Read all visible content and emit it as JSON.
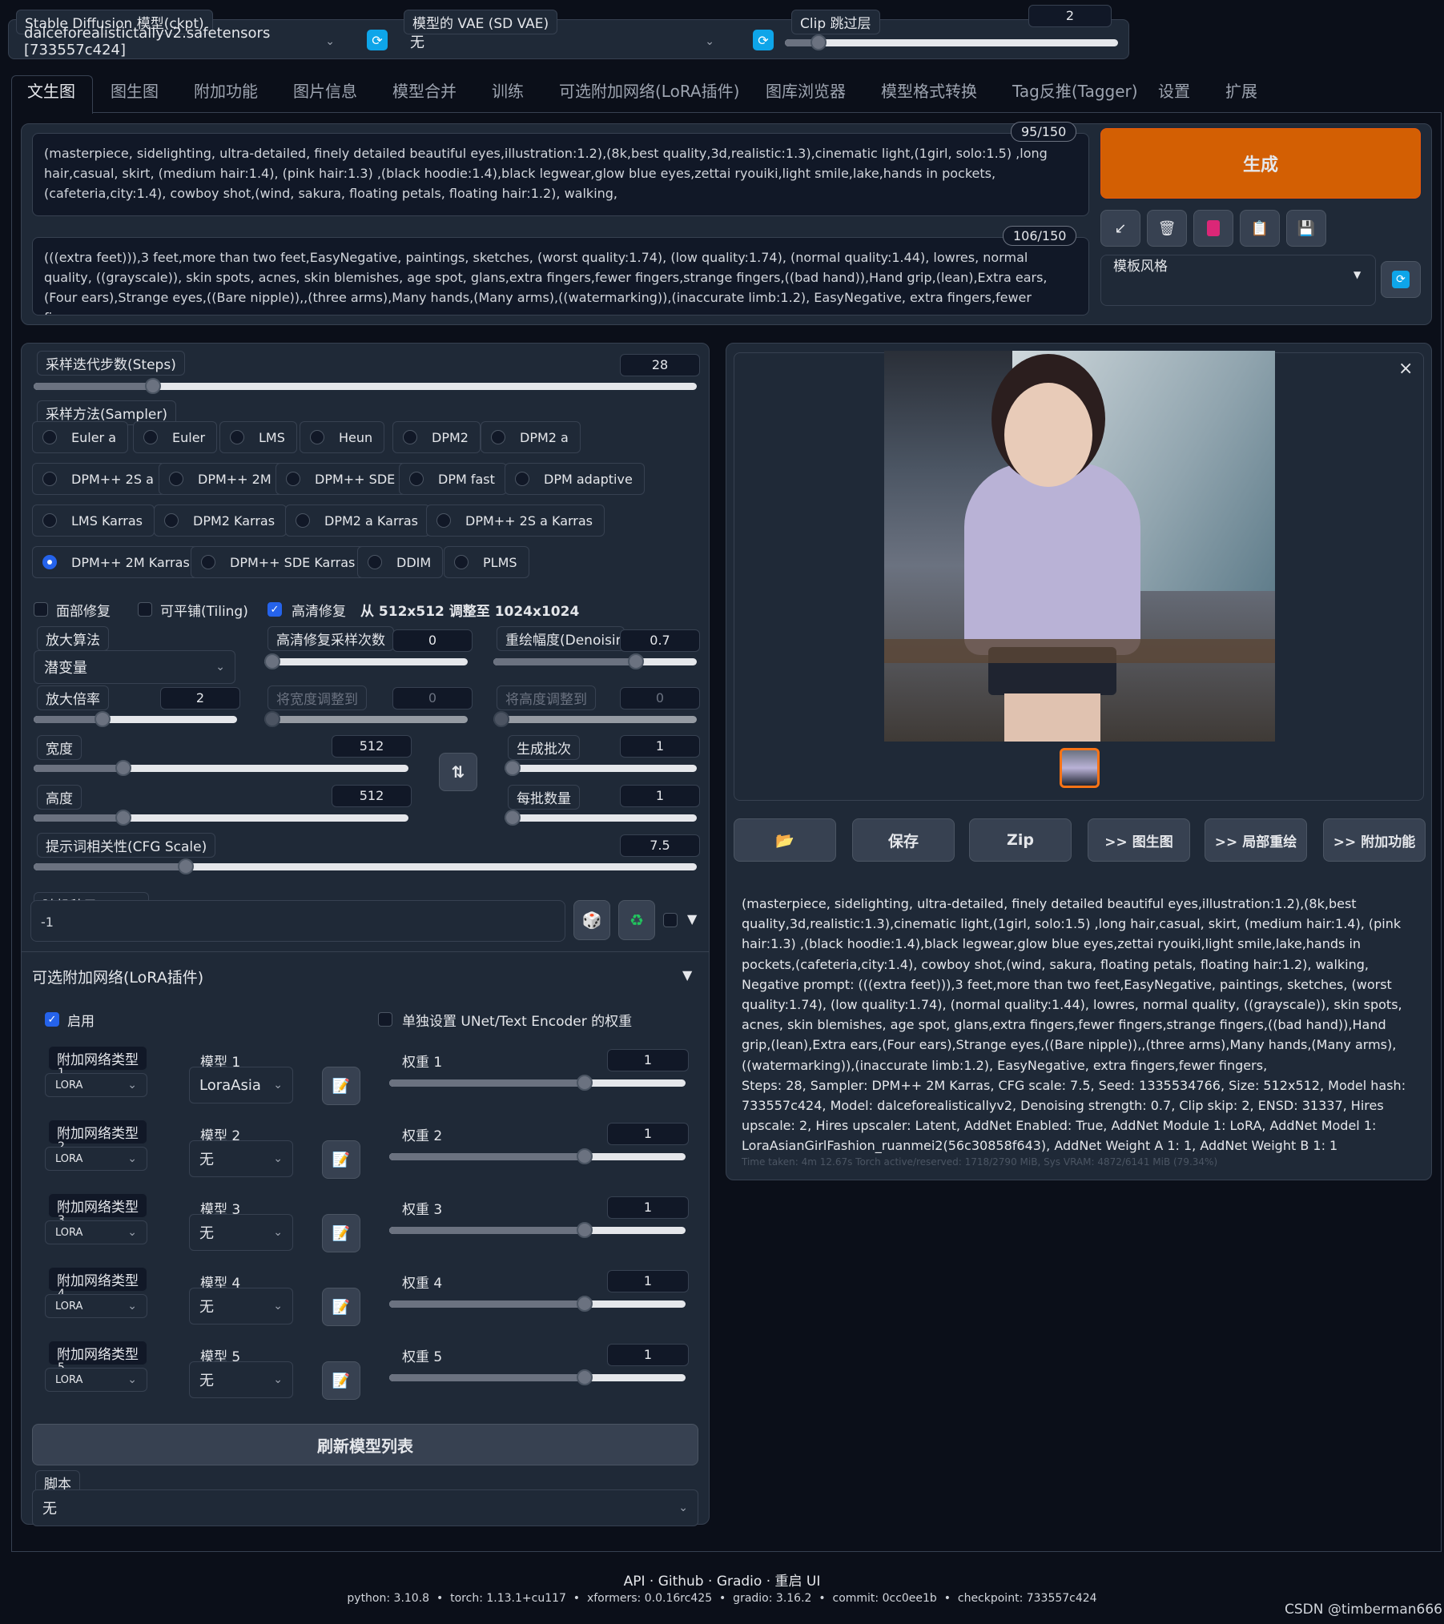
{
  "top": {
    "ckpt_label": "Stable Diffusion 模型(ckpt)",
    "ckpt_value": "dalceforealistictallyv2.safetensors [733557c424]",
    "vae_label": "模型的 VAE (SD VAE)",
    "vae_value": "无",
    "clip_label": "Clip 跳过层",
    "clip_value": "2",
    "clip_level": 0.1
  },
  "tabs": [
    "文生图",
    "图生图",
    "附加功能",
    "图片信息",
    "模型合并",
    "训练",
    "可选附加网络(LoRA插件)",
    "图库浏览器",
    "模型格式转换",
    "Tag反推(Tagger)",
    "设置",
    "扩展"
  ],
  "prompt": {
    "positive": "(masterpiece, sidelighting, ultra-detailed, finely detailed beautiful eyes,illustration:1.2),(8k,best quality,3d,realistic:1.3),cinematic light,(1girl, solo:1.5) ,long hair,casual, skirt, (medium hair:1.4), (pink hair:1.3) ,(black hoodie:1.4),black legwear,glow blue eyes,zettai ryouiki,light smile,lake,hands in pockets,(cafeteria,city:1.4), cowboy shot,(wind, sakura, floating petals, floating hair:1.2), walking,",
    "positive_count": "95/150",
    "negative": "(((extra feet))),3 feet,more than two feet,EasyNegative, paintings, sketches, (worst quality:1.74), (low quality:1.74), (normal quality:1.44), lowres, normal quality, ((grayscale)), skin spots, acnes, skin blemishes, age spot, glans,extra fingers,fewer fingers,strange fingers,((bad hand)),Hand grip,(lean),Extra ears,(Four ears),Strange eyes,((Bare nipple)),,(three arms),Many hands,(Many arms),((watermarking)),(inaccurate limb:1.2), EasyNegative, extra fingers,fewer fingers,",
    "negative_count": "106/150"
  },
  "generate": {
    "label": "生成",
    "color": "#d35f03",
    "style_label": "模板风格",
    "icons": [
      "arrow-icon",
      "trash-icon",
      "red-card-icon",
      "clipboard-icon",
      "save-icon"
    ]
  },
  "params": {
    "steps_label": "采样迭代步数(Steps)",
    "steps": "28",
    "steps_level": 0.18,
    "sampler_label": "采样方法(Sampler)",
    "samplers": [
      [
        "Euler a",
        "Euler",
        "LMS",
        "Heun",
        "DPM2",
        "DPM2 a"
      ],
      [
        "DPM++ 2S a",
        "DPM++ 2M",
        "DPM++ SDE",
        "DPM fast",
        "DPM adaptive"
      ],
      [
        "LMS Karras",
        "DPM2 Karras",
        "DPM2 a Karras",
        "DPM++ 2S a Karras"
      ],
      [
        "DPM++ 2M Karras",
        "DPM++ SDE Karras",
        "DDIM",
        "PLMS"
      ]
    ],
    "selected_sampler": "DPM++ 2M Karras",
    "face_restore": "面部修复",
    "tiling": "可平铺(Tiling)",
    "hires": "高清修复",
    "hires_note": "从 512x512 调整至 1024x1024",
    "upscaler_label": "放大算法",
    "upscaler_value": "潜变量",
    "hires_steps_label": "高清修复采样次数",
    "hires_steps": "0",
    "denoise_label": "重绘幅度(Denoising",
    "denoise": "0.7",
    "denoise_level": 0.7,
    "upscale_by_label": "放大倍率",
    "upscale_by": "2",
    "upscale_by_level": 0.34,
    "resize_w_label": "将宽度调整到",
    "resize_w": "0",
    "resize_h_label": "将高度调整到",
    "resize_h": "0",
    "width_label": "宽度",
    "width": "512",
    "width_level": 0.24,
    "height_label": "高度",
    "height": "512",
    "height_level": 0.24,
    "batch_count_label": "生成批次",
    "batch_count": "1",
    "batch_size_label": "每批数量",
    "batch_size": "1",
    "cfg_label": "提示词相关性(CFG Scale)",
    "cfg": "7.5",
    "cfg_level": 0.23,
    "seed_label": "随机种子(seed)",
    "seed": "-1"
  },
  "lora": {
    "title": "可选附加网络(LoRA插件)",
    "enable": "启用",
    "separate": "单独设置 UNet/Text Encoder 的权重",
    "rows": [
      {
        "type_label": "附加网络类型",
        "index": "1",
        "type_value": "LoRA",
        "model_label": "模型 1",
        "model_value": "LoraAsia",
        "weight_label": "权重 1",
        "weight": "1",
        "weight_level": 0.66
      },
      {
        "type_label": "附加网络类型",
        "index": "2",
        "type_value": "LoRA",
        "model_label": "模型 2",
        "model_value": "无",
        "weight_label": "权重 2",
        "weight": "1",
        "weight_level": 0.66
      },
      {
        "type_label": "附加网络类型",
        "index": "3",
        "type_value": "LoRA",
        "model_label": "模型 3",
        "model_value": "无",
        "weight_label": "权重 3",
        "weight": "1",
        "weight_level": 0.66
      },
      {
        "type_label": "附加网络类型",
        "index": "4",
        "type_value": "LoRA",
        "model_label": "模型 4",
        "model_value": "无",
        "weight_label": "权重 4",
        "weight": "1",
        "weight_level": 0.66
      },
      {
        "type_label": "附加网络类型",
        "index": "5",
        "type_value": "LoRA",
        "model_label": "模型 5",
        "model_value": "无",
        "weight_label": "权重 5",
        "weight": "1",
        "weight_level": 0.66
      }
    ],
    "refresh": "刷新模型列表"
  },
  "script": {
    "label": "脚本",
    "value": "无"
  },
  "output": {
    "buttons": [
      "保存",
      "Zip",
      ">> 图生图",
      ">> 局部重绘",
      ">> 附加功能"
    ],
    "info": "(masterpiece, sidelighting, ultra-detailed, finely detailed beautiful eyes,illustration:1.2),(8k,best quality,3d,realistic:1.3),cinematic light,(1girl, solo:1.5) ,long hair,casual, skirt, (medium hair:1.4), (pink hair:1.3) ,(black hoodie:1.4),black legwear,glow blue eyes,zettai ryouiki,light smile,lake,hands in pockets,(cafeteria,city:1.4), cowboy shot,(wind, sakura, floating petals, floating hair:1.2), walking,\nNegative prompt: (((extra feet))),3 feet,more than two feet,EasyNegative, paintings, sketches, (worst quality:1.74), (low quality:1.74), (normal quality:1.44), lowres, normal quality, ((grayscale)), skin spots, acnes, skin blemishes, age spot, glans,extra fingers,fewer fingers,strange fingers,((bad hand)),Hand grip,(lean),Extra ears,(Four ears),Strange eyes,((Bare nipple)),,(three arms),Many hands,(Many arms),((watermarking)),(inaccurate limb:1.2), EasyNegative, extra fingers,fewer fingers,\nSteps: 28, Sampler: DPM++ 2M Karras, CFG scale: 7.5, Seed: 1335534766, Size: 512x512, Model hash: 733557c424, Model: dalceforealisticallyv2, Denoising strength: 0.7, Clip skip: 2, ENSD: 31337, Hires upscale: 2, Hires upscaler: Latent, AddNet Enabled: True, AddNet Module 1: LoRA, AddNet Model 1: LoraAsianGirlFashion_ruanmei2(56c30858f643), AddNet Weight A 1: 1, AddNet Weight B 1: 1",
    "time": "Time taken: 4m 12.67s  Torch active/reserved: 1718/2790 MiB, Sys VRAM: 4872/6141 MiB (79.34%)"
  },
  "footer": {
    "links": "API · Github · Gradio · 重启 UI",
    "versions": "python: 3.10.8  •  torch: 1.13.1+cu117  •  xformers: 0.0.16rc425  •  gradio: 3.16.2  •  commit: 0cc0ee1b  •  checkpoint: 733557c424",
    "watermark": "CSDN @timberman666"
  }
}
